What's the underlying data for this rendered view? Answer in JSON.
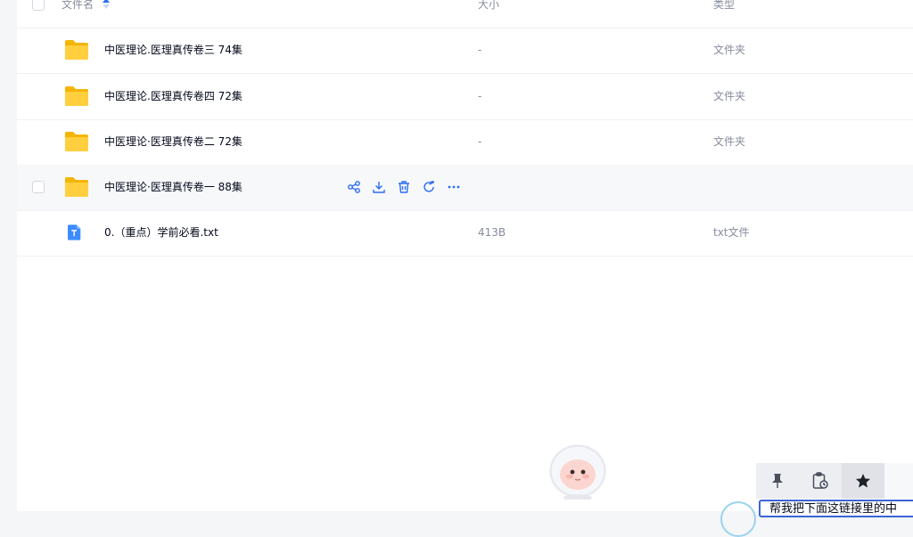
{
  "header": {
    "name_label": "文件名",
    "size_label": "大小",
    "type_label": "类型"
  },
  "files": [
    {
      "name": "中医理论.医理真传卷三 74集",
      "size": "-",
      "type": "文件夹",
      "icon": "folder-icon"
    },
    {
      "name": "中医理论.医理真传卷四 72集",
      "size": "-",
      "type": "文件夹",
      "icon": "folder-icon"
    },
    {
      "name": "中医理论·医理真传卷二 72集",
      "size": "-",
      "type": "文件夹",
      "icon": "folder-icon"
    },
    {
      "name": "中医理论·医理真传卷一 88集",
      "size": "",
      "type": "",
      "icon": "folder-icon",
      "hovered": true
    },
    {
      "name": "0.（重点）学前必看.txt",
      "size": "413B",
      "type": "txt文件",
      "icon": "txt-file-icon"
    }
  ],
  "row_actions": [
    "share-icon",
    "download-icon",
    "delete-icon",
    "refresh-icon",
    "more-icon"
  ],
  "bottom_toolbar": [
    "pin-icon",
    "clipboard-clock-icon",
    "star-icon"
  ],
  "chat_input": {
    "value": "帮我把下面这链接里的中"
  },
  "colors": {
    "accent": "#2b6cf5",
    "folder": "#ffc933",
    "txt": "#3d8cff",
    "muted": "#878c9c"
  }
}
